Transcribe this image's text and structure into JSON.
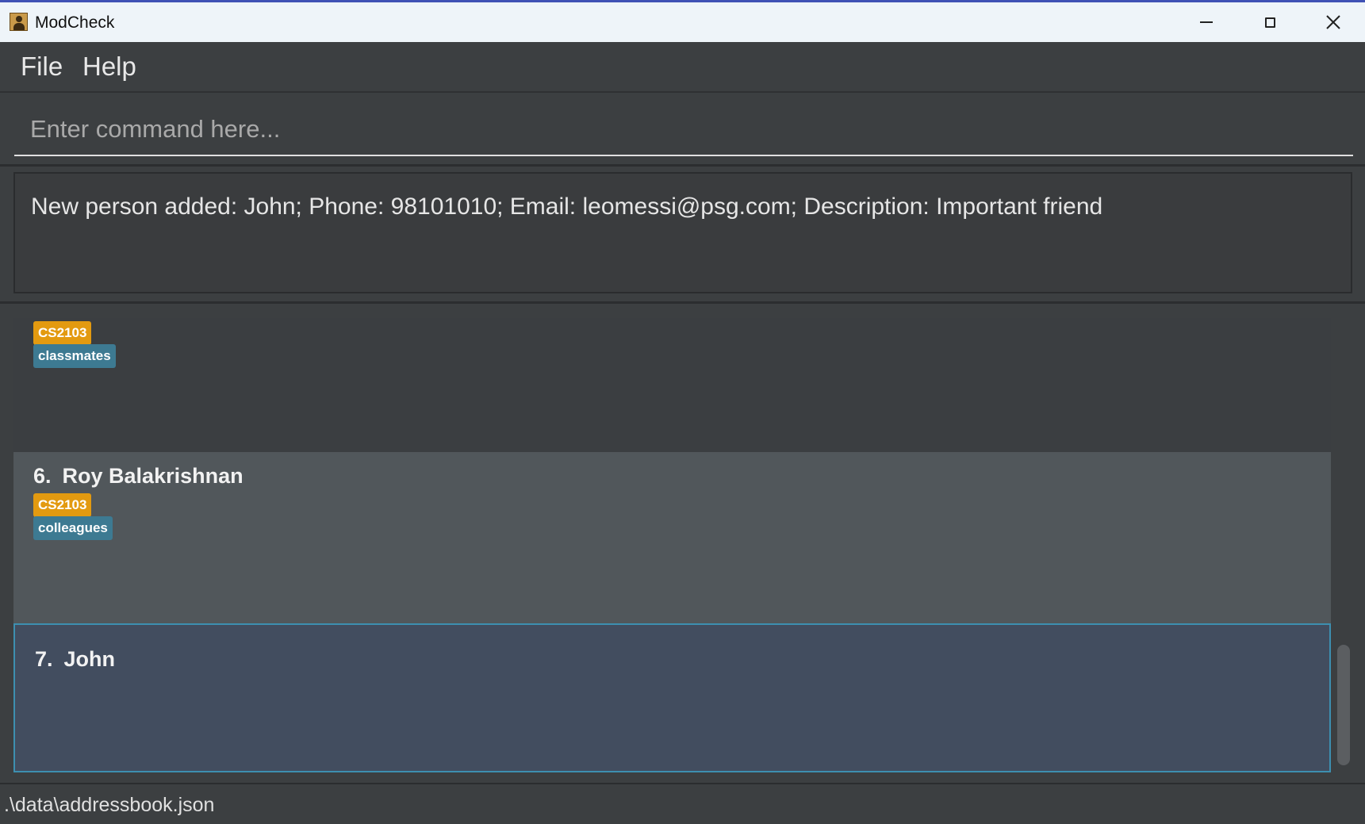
{
  "window": {
    "title": "ModCheck",
    "icon": "address-book-icon",
    "controls": [
      "minimize-icon",
      "maximize-icon",
      "close-icon"
    ]
  },
  "menu": {
    "file": "File",
    "help": "Help"
  },
  "command": {
    "placeholder": "Enter command here...",
    "value": ""
  },
  "result": {
    "message": "New person added: John; Phone: 98101010; Email: leomessi@psg.com; Description: Important friend"
  },
  "persons": [
    {
      "index": "",
      "name": "",
      "tags": [
        "CS2103",
        "classmates"
      ]
    },
    {
      "index": "6.",
      "name": "Roy Balakrishnan",
      "tags": [
        "CS2103",
        "colleagues"
      ]
    },
    {
      "index": "7.",
      "name": "John",
      "tags": [],
      "selected": true
    }
  ],
  "status": {
    "file_path": ".\\data\\addressbook.json"
  },
  "colors": {
    "accent": "#3f51b5",
    "module_tag": "#e39a10",
    "group_tag": "#3d7a92",
    "selected_border": "#3d8fb0"
  }
}
